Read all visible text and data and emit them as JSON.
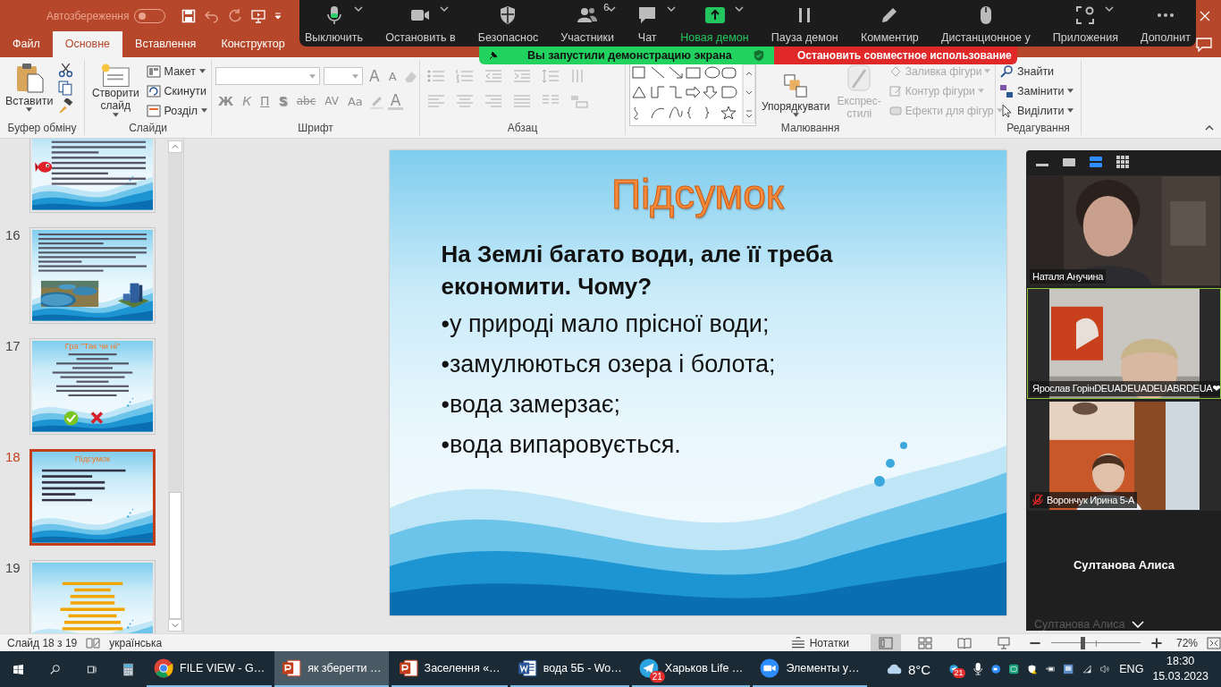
{
  "app_titlebar": {
    "autosave_label": "Автозбереження",
    "autosave_on": false
  },
  "ribbon_tabs": [
    {
      "label": "Файл",
      "selected": false
    },
    {
      "label": "Основне",
      "selected": true
    },
    {
      "label": "Вставлення",
      "selected": false
    },
    {
      "label": "Конструктор",
      "selected": false
    }
  ],
  "ribbon": {
    "clipboard": {
      "label": "Буфер обміну",
      "paste": "Вставити"
    },
    "slides": {
      "label": "Слайди",
      "new_slide": "Створити слайд",
      "items": [
        {
          "kind": "layout",
          "label": "Макет",
          "caret": true
        },
        {
          "kind": "reset",
          "label": "Скинути",
          "caret": false
        },
        {
          "kind": "section",
          "label": "Розділ",
          "caret": true
        }
      ]
    },
    "font": {
      "label": "Шрифт",
      "size_buttons": [
        "A",
        "A"
      ],
      "format_buttons": [
        {
          "kind": "bold",
          "label": "Ж"
        },
        {
          "kind": "italic",
          "label": "К"
        },
        {
          "kind": "underline",
          "label": "П"
        },
        {
          "kind": "shadow",
          "label": "S"
        },
        {
          "kind": "strike",
          "label": "abc"
        },
        {
          "kind": "spacing",
          "label": "AV"
        },
        {
          "kind": "case",
          "label": "Aa"
        }
      ],
      "color_button": "A"
    },
    "paragraph": {
      "label": "Абзац"
    },
    "drawing": {
      "label": "Малювання",
      "arrange": "Упорядкувати",
      "quick_styles": "Експрес-стилі",
      "quick_styles_disabled": true,
      "shape_options": [
        {
          "kind": "fill",
          "label": "Заливка фігури",
          "disabled": true
        },
        {
          "kind": "outline",
          "label": "Контур фігури",
          "disabled": true
        },
        {
          "kind": "effects",
          "label": "Ефекти для фігур",
          "disabled": true
        }
      ]
    },
    "editing": {
      "label": "Редагування",
      "items": [
        {
          "kind": "find",
          "label": "Знайти",
          "caret": false
        },
        {
          "kind": "replace",
          "label": "Замінити",
          "caret": true
        },
        {
          "kind": "select",
          "label": "Виділити",
          "caret": true
        }
      ]
    }
  },
  "meeting_toolbar": {
    "buttons": [
      {
        "kind": "mic",
        "label": "Выключить",
        "caret": true
      },
      {
        "kind": "camera",
        "label": "Остановить в",
        "caret": true
      },
      {
        "kind": "security",
        "label": "Безопаснос",
        "caret": false
      },
      {
        "kind": "participants",
        "label": "Участники",
        "caret": true,
        "count": "6"
      },
      {
        "kind": "chat",
        "label": "Чат",
        "caret": true
      },
      {
        "kind": "share",
        "label": "Новая демон",
        "caret": true
      },
      {
        "kind": "pause",
        "label": "Пауза демон",
        "caret": false
      },
      {
        "kind": "annotate",
        "label": "Комментир",
        "caret": false
      },
      {
        "kind": "remote",
        "label": "Дистанционное у",
        "caret": false
      },
      {
        "kind": "apps",
        "label": "Приложения",
        "caret": true
      },
      {
        "kind": "more",
        "label": "Дополнит",
        "caret": false
      }
    ]
  },
  "share_banner": {
    "status": "Вы запустили демонстрацию экрана",
    "stop": "Остановить совместное использование"
  },
  "thumbnails": [
    {
      "kind": "story",
      "selected": false
    },
    {
      "number": "16",
      "kind": "story_pictures",
      "selected": false
    },
    {
      "number": "17",
      "kind": "game",
      "selected": false,
      "title": "Гра \"Так чи ні\""
    },
    {
      "number": "18",
      "kind": "summary",
      "selected": true,
      "title": "Підсумок"
    },
    {
      "number": "19",
      "kind": "poem",
      "selected": false
    }
  ],
  "slide": {
    "title": "Підсумок",
    "question": "На Землі багато води, але її треба економити. Чому?",
    "bullets": [
      "•у природі мало прісної води;",
      "•замулюються озера і болота;",
      "•вода замерзає;",
      "•вода випаровується."
    ]
  },
  "video_panel": {
    "view_modes": [
      {
        "kind": "minimize",
        "selected": false
      },
      {
        "kind": "speaker",
        "selected": false
      },
      {
        "kind": "strip",
        "selected": true
      },
      {
        "kind": "gallery",
        "selected": false
      }
    ],
    "tiles": [
      {
        "kind": "video",
        "name": "Наталя Анучина",
        "speaking": false,
        "muted": false
      },
      {
        "kind": "video",
        "name": "Ярослав ГорінDEUADEUADEUABRDEUA❤",
        "speaking": true,
        "muted": false
      },
      {
        "kind": "video",
        "name": "Ворончук Ирина 5-А",
        "speaking": false,
        "muted": true
      },
      {
        "kind": "no_video",
        "name": "Султанова Алиса",
        "speaking": false
      }
    ],
    "footer_name": "Султанова Алиса"
  },
  "status_bar": {
    "slide_counter": "Слайд 18 з 19",
    "language": "українська",
    "notes": "Нотатки",
    "views": [
      {
        "kind": "normal",
        "selected": true
      },
      {
        "kind": "sorter",
        "selected": false
      },
      {
        "kind": "reading",
        "selected": false
      },
      {
        "kind": "show",
        "selected": false
      }
    ],
    "zoom": {
      "level": 0.35
    },
    "zoom_percent": "72%"
  },
  "taskbar": {
    "apps": [
      {
        "kind": "chrome",
        "label": "FILE VIEW - G…",
        "active": false
      },
      {
        "kind": "powerpoint",
        "label": "як зберегти …",
        "active": true
      },
      {
        "kind": "powerpoint",
        "label": "Заселення «…",
        "active": false
      },
      {
        "kind": "word",
        "label": "вода 5Б - Wo…",
        "active": false
      },
      {
        "kind": "telegram",
        "label": "Харьков Life …",
        "active": false,
        "badge": "21"
      },
      {
        "kind": "zoom",
        "label": "Элементы у…",
        "active": false
      }
    ],
    "weather": "8°C",
    "tray_badge": "21",
    "language": "ENG",
    "time": "18:30",
    "date": "15.03.2023"
  }
}
